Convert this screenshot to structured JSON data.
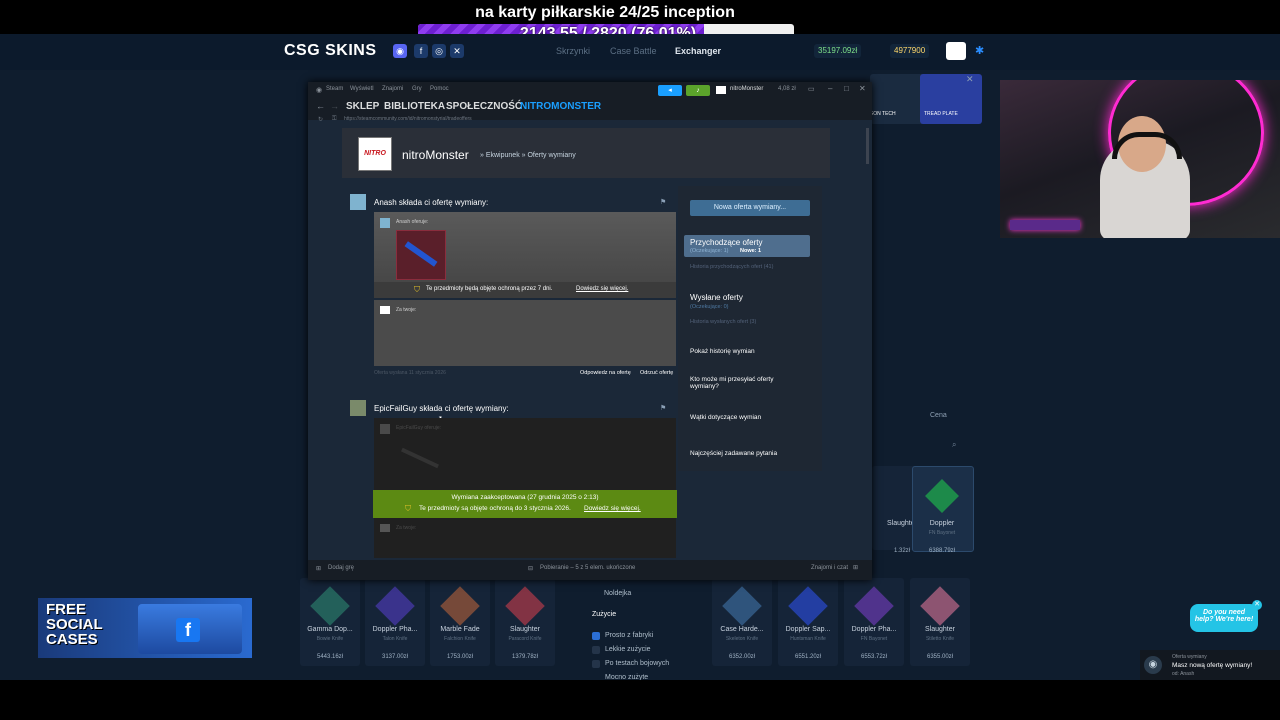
{
  "stream": {
    "goal_title": "na karty piłkarskie 24/25 inception",
    "goal_progress_text": "2143.55 / 2820 (76.01%)",
    "goal_fraction": 0.7601
  },
  "site": {
    "logo": "CSG SKINS",
    "nav": [
      "Skrzynki",
      "Case Battle",
      "Exchanger"
    ],
    "balance_a": "35197.09zł",
    "balance_b": "4977900",
    "top_cards": [
      "AGON TECH",
      "TREAD PLATE"
    ],
    "sort_label": "Cena",
    "filters": {
      "section": "Zużycie",
      "above": [
        "Noldejka"
      ],
      "options": [
        "Prosto z fabryki",
        "Lekkie zużycie",
        "Po testach bojowych",
        "Mocno zużyte"
      ]
    },
    "cards_row1": [
      {
        "name": "Slaughter",
        "sub": "",
        "price": "1.32zł"
      },
      {
        "name": "Doppler",
        "sub": "FN Bayonet",
        "price": "6388.79zł"
      }
    ],
    "cards_row2": [
      {
        "name": "Gamma Dop...",
        "sub": "Bowie Knife",
        "price": "5443.16zł"
      },
      {
        "name": "Doppler Pha...",
        "sub": "Talon Knife",
        "price": "3137.00zł"
      },
      {
        "name": "Marble Fade",
        "sub": "Falchion Knife",
        "price": "1753.00zł"
      },
      {
        "name": "Slaughter",
        "sub": "Paracord Knife",
        "price": "1379.78zł"
      },
      {
        "name": "Case Harde...",
        "sub": "Skeleton Knife",
        "price": "6352.00zł"
      },
      {
        "name": "Doppler Sap...",
        "sub": "Huntsman Knife",
        "price": "6551.20zł"
      },
      {
        "name": "Doppler Pha...",
        "sub": "FN Bayonet",
        "price": "6553.72zł"
      },
      {
        "name": "Slaughter",
        "sub": "Stiletto Knife",
        "price": "6355.00zł"
      }
    ]
  },
  "steam": {
    "menu": [
      "Steam",
      "Wyświetl",
      "Znajomi",
      "Gry",
      "Pomoc"
    ],
    "tabs": [
      "SKLEP",
      "BIBLIOTEKA",
      "SPOŁECZNOŚĆ",
      "NITROMONSTER"
    ],
    "user": "nitroMonster",
    "wallet": "4,08 zł",
    "url": "https://steamcommunity.com/id/nitromonstyrial/tradeoffers",
    "profile": {
      "avatar_text": "NITRO",
      "name": "nitroMonster",
      "crumb": "» Ekwipunek » Oferty wymiany"
    },
    "offer1": {
      "header": "Anash składa ci ofertę wymiany:",
      "their_label": "Anash oferuje:",
      "protection": "Te przedmioty będą objęte ochroną przez 7 dni.",
      "learn_more": "Dowiedz się więcej.",
      "your_label": "Za twoje:",
      "date": "Oferta wysłana 11 stycznia 2026",
      "reply": "Odpowiedz na ofertę",
      "decline": "Odrzuć ofertę"
    },
    "offer2": {
      "header": "EpicFailGuy składa ci ofertę wymiany:",
      "their_label": "EpicFailGuy oferuje:",
      "accepted": "Wymiana zaakceptowana (27 grudnia 2025 o 2:13)",
      "protection": "Te przedmioty są objęte ochroną do 3 stycznia 2026.",
      "learn_more": "Dowiedz się więcej.",
      "your_label": "Za twoje:"
    },
    "sidebar": {
      "new_offer": "Nowa oferta wymiany...",
      "incoming": "Przychodzące oferty",
      "incoming_sub": "(Oczekujące: 1)",
      "incoming_new": "Nowe: 1",
      "incoming_history": "Historia przychodzących ofert (41)",
      "sent": "Wysłane oferty",
      "sent_sub": "(Oczekujące: 0)",
      "sent_history": "Historia wysłanych ofert (3)",
      "links": [
        "Pokaż historię wymian",
        "Kto może mi przesyłać oferty wymiany?",
        "Wątki dotyczące wymian",
        "Najczęściej zadawane pytania"
      ]
    },
    "status": {
      "add_game": "Dodaj grę",
      "download": "Pobieranie – 5 z 5 elem. ukończone",
      "friends": "Znajomi i czat"
    }
  },
  "overlay": {
    "free_cases": "FREE SOCIAL CASES",
    "help": "Do you need help? We're here!",
    "notif_title": "Oferta wymiany",
    "notif_text": "Masz nową ofertę wymiany!",
    "notif_from": "od: Anash"
  },
  "colors": {
    "steam_blue": "#1a9fff",
    "accepted_green": "#5c8a13",
    "goal_purple": "#7a2ae0"
  }
}
